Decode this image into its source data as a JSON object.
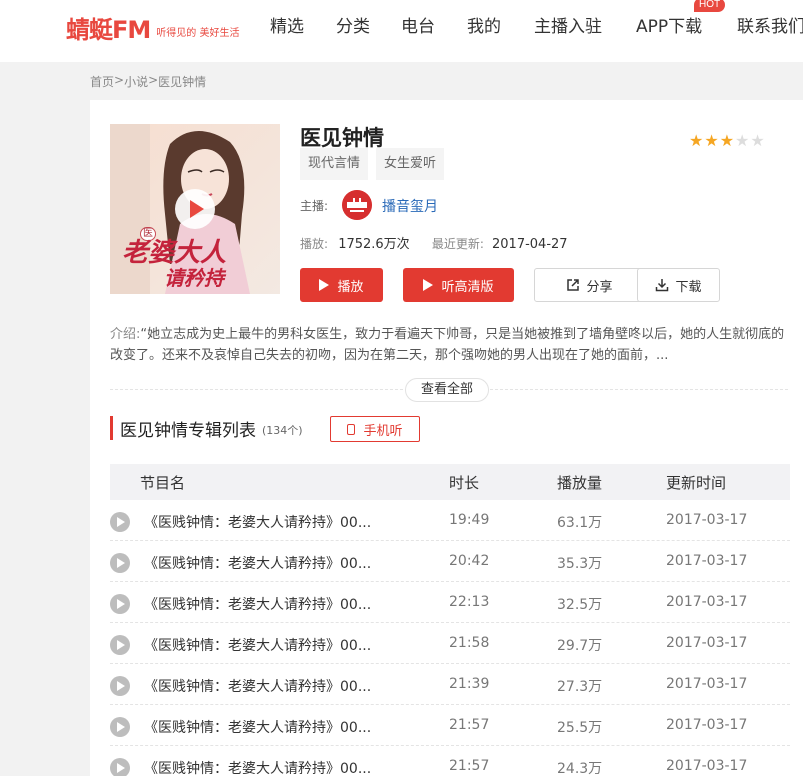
{
  "header": {
    "logo_text": "蜻蜓FM",
    "logo_slogan": "听得见的 美好生活",
    "nav": [
      "精选",
      "分类",
      "电台",
      "我的",
      "主播入驻",
      "APP下载",
      "联系我们"
    ],
    "hot_badge": "HOT"
  },
  "breadcrumb": [
    "首页",
    ">",
    "小说",
    ">",
    "医见钟情"
  ],
  "album": {
    "cover_text_line1": "老婆大人",
    "cover_text_line2": "请矜持",
    "cover_badge": "医",
    "title": "医见钟情",
    "rating": 3,
    "rating_max": 5,
    "tags": [
      "现代言情",
      "女生爱听"
    ],
    "host_label": "主播:",
    "host_name": "播音玺月",
    "plays_label": "播放:",
    "plays": "1752.6万次",
    "updated_label": "最近更新:",
    "updated": "2017-04-27",
    "buttons": {
      "play": "播放",
      "hq": "听高清版",
      "share": "分享",
      "download": "下载"
    },
    "intro_label": "介绍:",
    "intro_text": "“她立志成为史上最牛的男科女医生，致力于看遍天下帅哥，只是当她被推到了墙角壁咚以后，她的人生就彻底的改变了。还来不及哀悼自己失去的初吻，因为在第二天，那个强吻她的男人出现在了她的面前，...",
    "more": "查看全部"
  },
  "list": {
    "title": "医见钟情专辑列表",
    "count": "(134个)",
    "mobile_btn": "手机听",
    "columns": [
      "节目名",
      "时长",
      "播放量",
      "更新时间"
    ],
    "rows": [
      {
        "name": "《医贱钟情：老婆大人请矜持》00...",
        "duration": "19:49",
        "plays": "63.1万",
        "date": "2017-03-17"
      },
      {
        "name": "《医贱钟情：老婆大人请矜持》00...",
        "duration": "20:42",
        "plays": "35.3万",
        "date": "2017-03-17"
      },
      {
        "name": "《医贱钟情：老婆大人请矜持》00...",
        "duration": "22:13",
        "plays": "32.5万",
        "date": "2017-03-17"
      },
      {
        "name": "《医贱钟情：老婆大人请矜持》00...",
        "duration": "21:58",
        "plays": "29.7万",
        "date": "2017-03-17"
      },
      {
        "name": "《医贱钟情：老婆大人请矜持》00...",
        "duration": "21:39",
        "plays": "27.3万",
        "date": "2017-03-17"
      },
      {
        "name": "《医贱钟情：老婆大人请矜持》00...",
        "duration": "21:57",
        "plays": "25.5万",
        "date": "2017-03-17"
      },
      {
        "name": "《医贱钟情：老婆大人请矜持》00...",
        "duration": "21:57",
        "plays": "24.3万",
        "date": "2017-03-17"
      }
    ]
  },
  "colors": {
    "brand": "#e8483f",
    "button_red": "#e23a31",
    "link_blue": "#2a6ab8",
    "star": "#f5a623"
  }
}
